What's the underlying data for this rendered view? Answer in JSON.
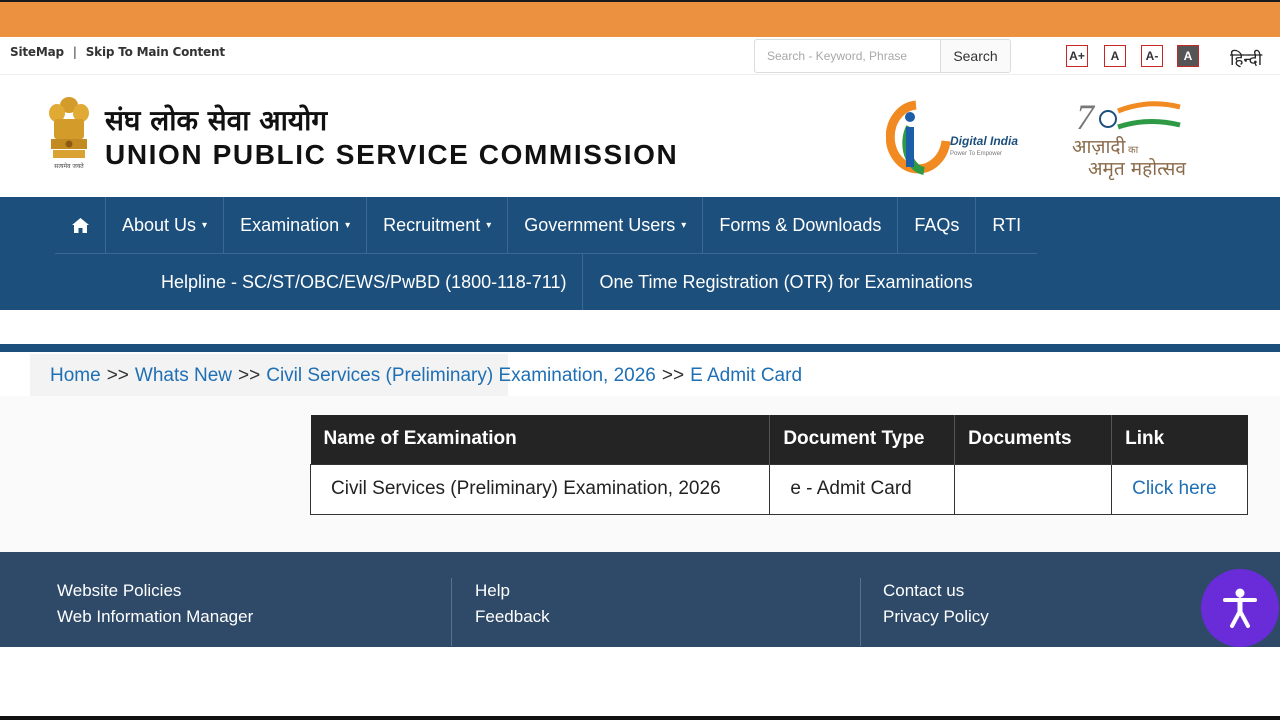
{
  "utility": {
    "sitemap": "SiteMap",
    "separator": "|",
    "skip": "Skip To Main Content",
    "search_placeholder": "Search - Keyword, Phrase",
    "search_button": "Search",
    "font_sizes": [
      "A+",
      "A",
      "A-",
      "A"
    ],
    "hindi": "हिन्दी"
  },
  "header": {
    "title_hindi": "संघ लोक सेवा आयोग",
    "title_english": "UNION PUBLIC SERVICE COMMISSION",
    "emblem_text": "सत्यमेव जयते",
    "digital_india": "Digital India",
    "digital_india_tagline": "Power To Empower",
    "azadi_line1": "आज़ादी",
    "azadi_ka": "का",
    "azadi_line2": "अमृत महोत्सव"
  },
  "nav": {
    "row1": [
      {
        "label": "About Us",
        "dropdown": true
      },
      {
        "label": "Examination",
        "dropdown": true
      },
      {
        "label": "Recruitment",
        "dropdown": true
      },
      {
        "label": "Government Users",
        "dropdown": true
      },
      {
        "label": "Forms & Downloads",
        "dropdown": false
      },
      {
        "label": "FAQs",
        "dropdown": false
      },
      {
        "label": "RTI",
        "dropdown": false
      }
    ],
    "row2": [
      {
        "label": "Helpline - SC/ST/OBC/EWS/PwBD (1800-118-711)"
      },
      {
        "label": "One Time Registration (OTR) for Examinations"
      }
    ],
    "caret": "▾"
  },
  "breadcrumb": {
    "items": [
      "Home",
      "Whats New",
      "Civil Services (Preliminary) Examination, 2026",
      "E Admit Card"
    ],
    "separator": ">>"
  },
  "table": {
    "headers": [
      "Name of Examination",
      "Document Type",
      "Documents",
      "Link"
    ],
    "rows": [
      {
        "name": "Civil Services (Preliminary) Examination, 2026",
        "doc_type": "e - Admit Card",
        "documents": "",
        "link": "Click here"
      }
    ]
  },
  "footer": {
    "col1": [
      "Website Policies",
      "Web Information Manager"
    ],
    "col2": [
      "Help",
      "Feedback"
    ],
    "col3": [
      "Contact us",
      "Privacy Policy"
    ]
  },
  "colors": {
    "orange": "#ec913f",
    "nav_blue": "#1d4f7c",
    "footer_blue": "#2e4a68",
    "link_blue": "#1f6fb5",
    "accessibility_purple": "#6a2cd8"
  }
}
